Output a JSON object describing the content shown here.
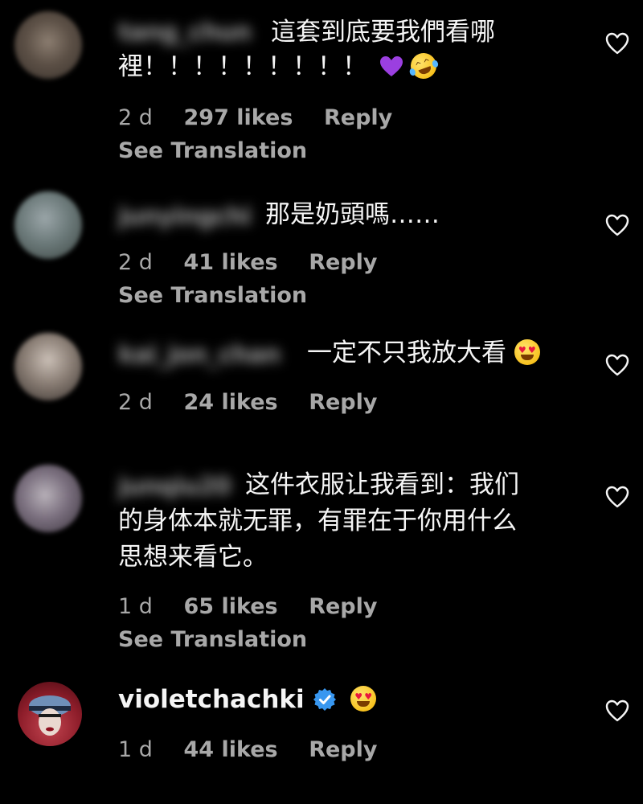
{
  "comments": [
    {
      "username": "tang_chun",
      "text_lines": [
        "這套到底要我們看哪",
        "裡！！！！！！！！！"
      ],
      "time": "2 d",
      "likes": "297 likes",
      "reply": "Reply",
      "see_translation": "See Translation",
      "emojis": [
        "purple-heart",
        "rolling-laugh"
      ]
    },
    {
      "username": "junyingchi",
      "text_lines": [
        "那是奶頭嗎……"
      ],
      "time": "2 d",
      "likes": "41 likes",
      "reply": "Reply",
      "see_translation": "See Translation"
    },
    {
      "username": "kai_jon_chan",
      "text_lines": [
        "一定不只我放大看"
      ],
      "time": "2 d",
      "likes": "24 likes",
      "reply": "Reply",
      "emojis": [
        "heart-eyes"
      ]
    },
    {
      "username": "junqiu20",
      "text_lines": [
        "这件衣服让我看到：我们",
        "的身体本就无罪，有罪在于你用什么",
        "思想来看它。"
      ],
      "time": "1 d",
      "likes": "65 likes",
      "reply": "Reply",
      "see_translation": "See Translation"
    },
    {
      "username": "violetchachki",
      "verified": true,
      "text_lines": [],
      "time": "1 d",
      "likes": "44 likes",
      "reply": "Reply",
      "emojis": [
        "heart-eyes"
      ]
    }
  ],
  "colors": {
    "background": "#000000",
    "text": "#f5f5f5",
    "secondary": "#a8a8a8",
    "verified": "#3897f0",
    "purple_heart": "#9b3fe0"
  }
}
